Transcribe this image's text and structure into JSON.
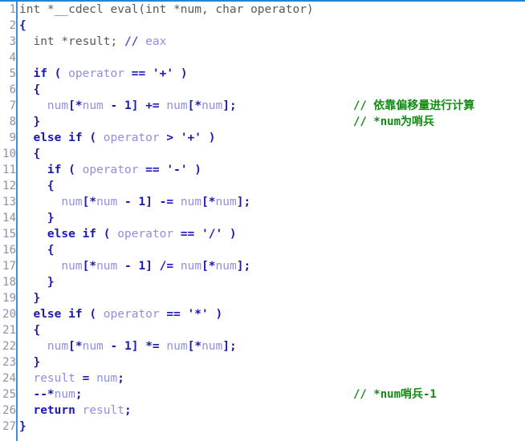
{
  "editor": {
    "title": "decompiled-code-view",
    "background": "#ffffff",
    "accent_blue": "#1e86d8",
    "gutter_rule_color": "#3f8fd2",
    "line_number_color": "#8b93a8",
    "comment_green": "#148a14",
    "keyword_blue": "#1a1ab4",
    "variable_periwinkle": "#8f8fe0",
    "plain_gray": "#57585a",
    "first_line_number": 1,
    "last_line_number": 27,
    "total_lines": 27
  },
  "line_numbers": [
    "1",
    "2",
    "3",
    "4",
    "5",
    "6",
    "7",
    "8",
    "9",
    "10",
    "11",
    "12",
    "13",
    "14",
    "15",
    "16",
    "17",
    "18",
    "19",
    "20",
    "21",
    "22",
    "23",
    "24",
    "25",
    "26",
    "27"
  ],
  "lines": [
    {
      "n": "1",
      "text": "int *__cdecl eval(int *num, char operator)",
      "comment": ""
    },
    {
      "n": "2",
      "text": "{",
      "comment": ""
    },
    {
      "n": "3",
      "text": "  int *result; // eax",
      "comment": ""
    },
    {
      "n": "4",
      "text": "",
      "comment": ""
    },
    {
      "n": "5",
      "text": "  if ( operator == '+' )",
      "comment": ""
    },
    {
      "n": "6",
      "text": "  {",
      "comment": ""
    },
    {
      "n": "7",
      "text": "    num[*num - 1] += num[*num];",
      "comment": "// 依靠偏移量进行计算"
    },
    {
      "n": "8",
      "text": "  }",
      "comment": "// *num为哨兵"
    },
    {
      "n": "9",
      "text": "  else if ( operator > '+' )",
      "comment": ""
    },
    {
      "n": "10",
      "text": "  {",
      "comment": ""
    },
    {
      "n": "11",
      "text": "    if ( operator == '-' )",
      "comment": ""
    },
    {
      "n": "12",
      "text": "    {",
      "comment": ""
    },
    {
      "n": "13",
      "text": "      num[*num - 1] -= num[*num];",
      "comment": ""
    },
    {
      "n": "14",
      "text": "    }",
      "comment": ""
    },
    {
      "n": "15",
      "text": "    else if ( operator == '/' )",
      "comment": ""
    },
    {
      "n": "16",
      "text": "    {",
      "comment": ""
    },
    {
      "n": "17",
      "text": "      num[*num - 1] /= num[*num];",
      "comment": ""
    },
    {
      "n": "18",
      "text": "    }",
      "comment": ""
    },
    {
      "n": "19",
      "text": "  }",
      "comment": ""
    },
    {
      "n": "20",
      "text": "  else if ( operator == '*' )",
      "comment": ""
    },
    {
      "n": "21",
      "text": "  {",
      "comment": ""
    },
    {
      "n": "22",
      "text": "    num[*num - 1] *= num[*num];",
      "comment": ""
    },
    {
      "n": "23",
      "text": "  }",
      "comment": ""
    },
    {
      "n": "24",
      "text": "  result = num;",
      "comment": ""
    },
    {
      "n": "25",
      "text": "  --*num;",
      "comment": "// *num哨兵-1"
    },
    {
      "n": "26",
      "text": "  return result;",
      "comment": ""
    },
    {
      "n": "27",
      "text": "}",
      "comment": ""
    }
  ],
  "tokens": {
    "1": [
      [
        "plain",
        "int *__cdecl eval(int *num, char operator)"
      ]
    ],
    "2": [
      [
        "punc",
        "{"
      ]
    ],
    "3": [
      [
        "plain",
        "  int *result; "
      ],
      [
        "cmt-mark",
        "// "
      ],
      [
        "cmt",
        "eax"
      ]
    ],
    "4": [
      [
        "plain",
        ""
      ]
    ],
    "5": [
      [
        "plain",
        "  "
      ],
      [
        "kw",
        "if"
      ],
      [
        "plain",
        " "
      ],
      [
        "punc",
        "( "
      ],
      [
        "var",
        "operator"
      ],
      [
        "op",
        " == "
      ],
      [
        "char",
        "'+'"
      ],
      [
        "punc",
        " )"
      ]
    ],
    "6": [
      [
        "plain",
        "  "
      ],
      [
        "punc",
        "{"
      ]
    ],
    "7": [
      [
        "plain",
        "    "
      ],
      [
        "var",
        "num"
      ],
      [
        "punc",
        "["
      ],
      [
        "op",
        "*"
      ],
      [
        "var",
        "num"
      ],
      [
        "op",
        " - "
      ],
      [
        "num",
        "1"
      ],
      [
        "punc",
        "]"
      ],
      [
        "op",
        " += "
      ],
      [
        "var",
        "num"
      ],
      [
        "punc",
        "["
      ],
      [
        "op",
        "*"
      ],
      [
        "var",
        "num"
      ],
      [
        "punc",
        "];"
      ]
    ],
    "8": [
      [
        "plain",
        "  "
      ],
      [
        "punc",
        "}"
      ]
    ],
    "9": [
      [
        "plain",
        "  "
      ],
      [
        "kw",
        "else if"
      ],
      [
        "plain",
        " "
      ],
      [
        "punc",
        "( "
      ],
      [
        "var",
        "operator"
      ],
      [
        "op",
        " > "
      ],
      [
        "char",
        "'+'"
      ],
      [
        "punc",
        " )"
      ]
    ],
    "10": [
      [
        "plain",
        "  "
      ],
      [
        "punc",
        "{"
      ]
    ],
    "11": [
      [
        "plain",
        "    "
      ],
      [
        "kw",
        "if"
      ],
      [
        "plain",
        " "
      ],
      [
        "punc",
        "( "
      ],
      [
        "var",
        "operator"
      ],
      [
        "op",
        " == "
      ],
      [
        "char",
        "'-'"
      ],
      [
        "punc",
        " )"
      ]
    ],
    "12": [
      [
        "plain",
        "    "
      ],
      [
        "punc",
        "{"
      ]
    ],
    "13": [
      [
        "plain",
        "      "
      ],
      [
        "var",
        "num"
      ],
      [
        "punc",
        "["
      ],
      [
        "op",
        "*"
      ],
      [
        "var",
        "num"
      ],
      [
        "op",
        " - "
      ],
      [
        "num",
        "1"
      ],
      [
        "punc",
        "]"
      ],
      [
        "op",
        " -= "
      ],
      [
        "var",
        "num"
      ],
      [
        "punc",
        "["
      ],
      [
        "op",
        "*"
      ],
      [
        "var",
        "num"
      ],
      [
        "punc",
        "];"
      ]
    ],
    "14": [
      [
        "plain",
        "    "
      ],
      [
        "punc",
        "}"
      ]
    ],
    "15": [
      [
        "plain",
        "    "
      ],
      [
        "kw",
        "else if"
      ],
      [
        "plain",
        " "
      ],
      [
        "punc",
        "( "
      ],
      [
        "var",
        "operator"
      ],
      [
        "op",
        " == "
      ],
      [
        "char",
        "'/'"
      ],
      [
        "punc",
        " )"
      ]
    ],
    "16": [
      [
        "plain",
        "    "
      ],
      [
        "punc",
        "{"
      ]
    ],
    "17": [
      [
        "plain",
        "      "
      ],
      [
        "var",
        "num"
      ],
      [
        "punc",
        "["
      ],
      [
        "op",
        "*"
      ],
      [
        "var",
        "num"
      ],
      [
        "op",
        " - "
      ],
      [
        "num",
        "1"
      ],
      [
        "punc",
        "]"
      ],
      [
        "op",
        " /= "
      ],
      [
        "var",
        "num"
      ],
      [
        "punc",
        "["
      ],
      [
        "op",
        "*"
      ],
      [
        "var",
        "num"
      ],
      [
        "punc",
        "];"
      ]
    ],
    "18": [
      [
        "plain",
        "    "
      ],
      [
        "punc",
        "}"
      ]
    ],
    "19": [
      [
        "plain",
        "  "
      ],
      [
        "punc",
        "}"
      ]
    ],
    "20": [
      [
        "plain",
        "  "
      ],
      [
        "kw",
        "else if"
      ],
      [
        "plain",
        " "
      ],
      [
        "punc",
        "( "
      ],
      [
        "var",
        "operator"
      ],
      [
        "op",
        " == "
      ],
      [
        "char",
        "'*'"
      ],
      [
        "punc",
        " )"
      ]
    ],
    "21": [
      [
        "plain",
        "  "
      ],
      [
        "punc",
        "{"
      ]
    ],
    "22": [
      [
        "plain",
        "    "
      ],
      [
        "var",
        "num"
      ],
      [
        "punc",
        "["
      ],
      [
        "op",
        "*"
      ],
      [
        "var",
        "num"
      ],
      [
        "op",
        " - "
      ],
      [
        "num",
        "1"
      ],
      [
        "punc",
        "]"
      ],
      [
        "op",
        " *= "
      ],
      [
        "var",
        "num"
      ],
      [
        "punc",
        "["
      ],
      [
        "op",
        "*"
      ],
      [
        "var",
        "num"
      ],
      [
        "punc",
        "];"
      ]
    ],
    "23": [
      [
        "plain",
        "  "
      ],
      [
        "punc",
        "}"
      ]
    ],
    "24": [
      [
        "plain",
        "  "
      ],
      [
        "var",
        "result"
      ],
      [
        "op",
        " = "
      ],
      [
        "var",
        "num"
      ],
      [
        "punc",
        ";"
      ]
    ],
    "25": [
      [
        "plain",
        "  "
      ],
      [
        "op",
        "--*"
      ],
      [
        "var",
        "num"
      ],
      [
        "punc",
        ";"
      ]
    ],
    "26": [
      [
        "plain",
        "  "
      ],
      [
        "kw",
        "return"
      ],
      [
        "plain",
        " "
      ],
      [
        "var",
        "result"
      ],
      [
        "punc",
        ";"
      ]
    ],
    "27": [
      [
        "punc",
        "}"
      ]
    ]
  }
}
